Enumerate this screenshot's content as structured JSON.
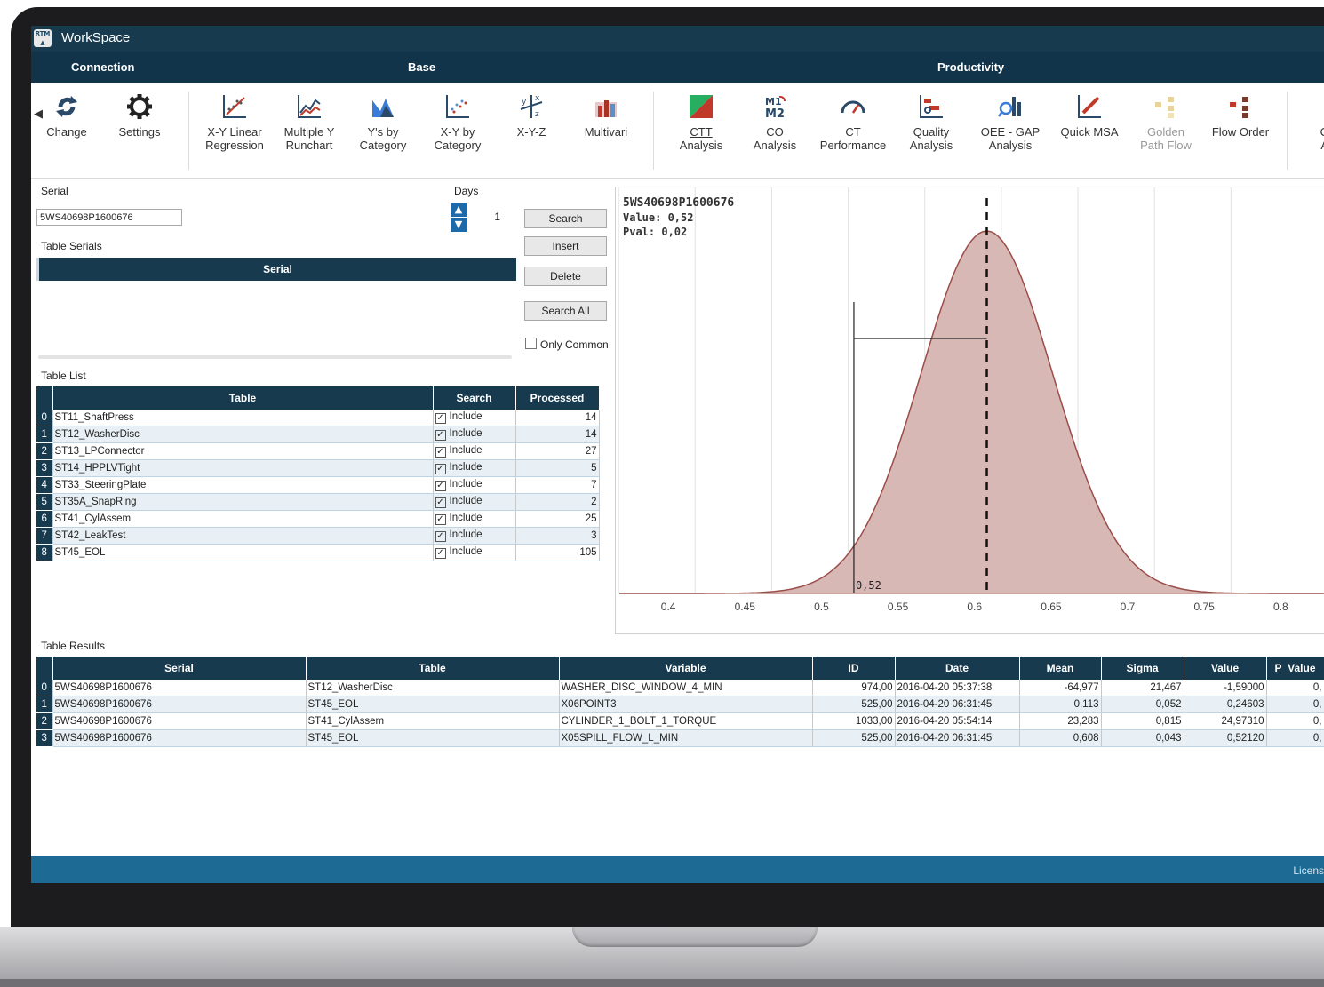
{
  "app": {
    "title": "WorkSpace",
    "logo_text": "RTM"
  },
  "sections": {
    "connection": "Connection",
    "base": "Base",
    "productivity": "Productivity"
  },
  "ribbon": {
    "change": "Change",
    "settings": "Settings",
    "xy_linear_1": "X-Y Linear",
    "xy_linear_2": "Regression",
    "multi_y_1": "Multiple Y",
    "multi_y_2": "Runchart",
    "ys_cat_1": "Y's by",
    "ys_cat_2": "Category",
    "xy_cat_1": "X-Y by",
    "xy_cat_2": "Category",
    "xyz": "X-Y-Z",
    "multivari": "Multivari",
    "ctt_1": "CTT",
    "ctt_2": "Analysis",
    "co_1": "CO",
    "co_2": "Analysis",
    "ct_1": "CT",
    "ct_2": "Performance",
    "quality_1": "Quality",
    "quality_2": "Analysis",
    "oee_1": "OEE - GAP",
    "oee_2": "Analysis",
    "quick_msa": "Quick MSA",
    "golden_1": "Golden",
    "golden_2": "Path Flow",
    "flow_order": "Flow Order",
    "next_1": "C",
    "next_2": "A"
  },
  "search_panel": {
    "serial_label": "Serial",
    "serial_value": "5WS40698P1600676",
    "days_label": "Days",
    "days_value": "1",
    "table_serials_label": "Table Serials",
    "serial_header": "Serial",
    "buttons": {
      "search": "Search",
      "insert": "Insert",
      "delete": "Delete",
      "search_all": "Search All"
    },
    "only_common": "Only Common"
  },
  "table_list": {
    "label": "Table List",
    "headers": [
      "Table",
      "Search",
      "Processed"
    ],
    "rows": [
      {
        "idx": "0",
        "table": "ST11_ShaftPress",
        "search": "Include",
        "processed": "14"
      },
      {
        "idx": "1",
        "table": "ST12_WasherDisc",
        "search": "Include",
        "processed": "14"
      },
      {
        "idx": "2",
        "table": "ST13_LPConnector",
        "search": "Include",
        "processed": "27"
      },
      {
        "idx": "3",
        "table": "ST14_HPPLVTight",
        "search": "Include",
        "processed": "5"
      },
      {
        "idx": "4",
        "table": "ST33_SteeringPlate",
        "search": "Include",
        "processed": "7"
      },
      {
        "idx": "5",
        "table": "ST35A_SnapRing",
        "search": "Include",
        "processed": "2"
      },
      {
        "idx": "6",
        "table": "ST41_CylAssem",
        "search": "Include",
        "processed": "25"
      },
      {
        "idx": "7",
        "table": "ST42_LeakTest",
        "search": "Include",
        "processed": "3"
      },
      {
        "idx": "8",
        "table": "ST45_EOL",
        "search": "Include",
        "processed": "105"
      }
    ]
  },
  "chart_data": {
    "type": "area",
    "title": "5WS40698P1600676",
    "value_text": "Value: 0,52",
    "pval_text": "Pval: 0,02",
    "marker_label": "0,52",
    "mean": 0.608,
    "sigma": 0.043,
    "value": 0.5212,
    "xlim": [
      0.368,
      0.83
    ],
    "xticks": [
      {
        "v": 0.4,
        "label": "0.4"
      },
      {
        "v": 0.45,
        "label": "0.45"
      },
      {
        "v": 0.5,
        "label": "0.5"
      },
      {
        "v": 0.55,
        "label": "0.55"
      },
      {
        "v": 0.6,
        "label": "0.6"
      },
      {
        "v": 0.65,
        "label": "0.65"
      },
      {
        "v": 0.7,
        "label": "0.7"
      },
      {
        "v": 0.75,
        "label": "0.75"
      },
      {
        "v": 0.8,
        "label": "0.8"
      }
    ],
    "colors": {
      "fill": "#d8b8b4",
      "line": "#9b4d4a",
      "grid": "#e2e2e2"
    }
  },
  "results": {
    "label": "Table Results",
    "headers": [
      "Serial",
      "Table",
      "Variable",
      "ID",
      "Date",
      "Mean",
      "Sigma",
      "Value",
      "P_Value"
    ],
    "rows": [
      {
        "idx": "0",
        "serial": "5WS40698P1600676",
        "table": "ST12_WasherDisc",
        "variable": "WASHER_DISC_WINDOW_4_MIN",
        "id": "974,00",
        "date": "2016-04-20 05:37:38",
        "mean": "-64,977",
        "sigma": "21,467",
        "value": "-1,59000",
        "pval": "0,"
      },
      {
        "idx": "1",
        "serial": "5WS40698P1600676",
        "table": "ST45_EOL",
        "variable": "X06POINT3",
        "id": "525,00",
        "date": "2016-04-20 06:31:45",
        "mean": "0,113",
        "sigma": "0,052",
        "value": "0,24603",
        "pval": "0,"
      },
      {
        "idx": "2",
        "serial": "5WS40698P1600676",
        "table": "ST41_CylAssem",
        "variable": "CYLINDER_1_BOLT_1_TORQUE",
        "id": "1033,00",
        "date": "2016-04-20 05:54:14",
        "mean": "23,283",
        "sigma": "0,815",
        "value": "24,97310",
        "pval": "0,"
      },
      {
        "idx": "3",
        "serial": "5WS40698P1600676",
        "table": "ST45_EOL",
        "variable": "X05SPILL_FLOW_L_MIN",
        "id": "525,00",
        "date": "2016-04-20 06:31:45",
        "mean": "0,608",
        "sigma": "0,043",
        "value": "0,52120",
        "pval": "0,"
      }
    ]
  },
  "status": {
    "license": "Licens"
  }
}
